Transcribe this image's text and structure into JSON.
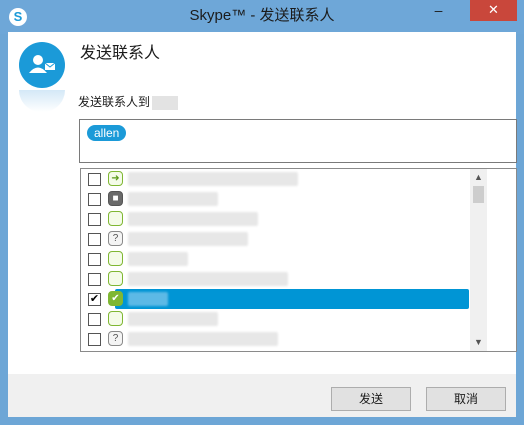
{
  "window": {
    "title": "Skype™ - 发送联系人",
    "app_icon_letter": "S",
    "minimize_glyph": "–",
    "close_glyph": "✕"
  },
  "dialog": {
    "heading": "发送联系人",
    "prompt": "发送联系人到",
    "recipient_chip": "allen"
  },
  "contacts": [
    {
      "checked": false,
      "status": "forward",
      "glyph": "➜"
    },
    {
      "checked": false,
      "status": "dark",
      "glyph": "■"
    },
    {
      "checked": false,
      "status": "online",
      "glyph": ""
    },
    {
      "checked": false,
      "status": "unknown",
      "glyph": "?"
    },
    {
      "checked": false,
      "status": "online",
      "glyph": ""
    },
    {
      "checked": false,
      "status": "online",
      "glyph": ""
    },
    {
      "checked": true,
      "status": "check",
      "glyph": "✔"
    },
    {
      "checked": false,
      "status": "online",
      "glyph": ""
    },
    {
      "checked": false,
      "status": "unknown",
      "glyph": "?"
    }
  ],
  "scrollbar": {
    "up": "▲",
    "down": "▼"
  },
  "buttons": {
    "send": "发送",
    "cancel": "取消"
  },
  "colors": {
    "accent": "#1b9ad8",
    "selection": "#0095d5",
    "titlebar": "#6ea7d8",
    "close": "#c9473b"
  }
}
